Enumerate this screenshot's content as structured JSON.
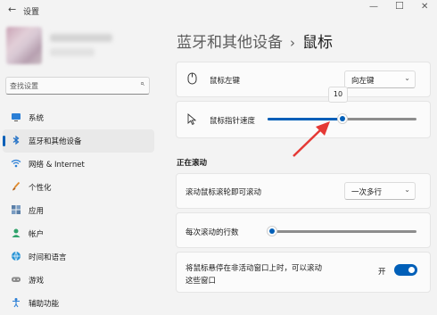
{
  "window": {
    "title": "设置",
    "back_glyph": "←",
    "minimize_glyph": "—",
    "maximize_glyph": "☐",
    "close_glyph": "✕"
  },
  "search": {
    "placeholder": "查找设置",
    "value": ""
  },
  "sidebar": {
    "items": [
      {
        "label": "系统",
        "icon": "monitor-icon",
        "active": false
      },
      {
        "label": "蓝牙和其他设备",
        "icon": "bluetooth-icon",
        "active": true
      },
      {
        "label": "网络 & Internet",
        "icon": "wifi-icon",
        "active": false
      },
      {
        "label": "个性化",
        "icon": "brush-icon",
        "active": false
      },
      {
        "label": "应用",
        "icon": "apps-icon",
        "active": false
      },
      {
        "label": "帐户",
        "icon": "person-icon",
        "active": false
      },
      {
        "label": "时间和语言",
        "icon": "globe-clock-icon",
        "active": false
      },
      {
        "label": "游戏",
        "icon": "gamepad-icon",
        "active": false
      },
      {
        "label": "辅助功能",
        "icon": "accessibility-icon",
        "active": false
      }
    ]
  },
  "breadcrumb": {
    "parent": "蓝牙和其他设备",
    "separator": "›",
    "current": "鼠标"
  },
  "settings": {
    "primary_button": {
      "label": "鼠标左键",
      "value": "向左键",
      "icon": "mouse-icon"
    },
    "pointer_speed": {
      "label": "鼠标指针速度",
      "value": 10,
      "max": 20,
      "tooltip": "10",
      "icon": "pointer-icon"
    },
    "scrolling_section": "正在滚动",
    "scroll_mode": {
      "label": "滚动鼠标滚轮即可滚动",
      "value": "一次多行"
    },
    "lines_per_scroll": {
      "label": "每次滚动的行数",
      "value": 3,
      "min": 1,
      "max": 100
    },
    "inactive_scroll": {
      "label_line1": "将鼠标悬停在非活动窗口上时，可以滚动",
      "label_line2": "这些窗口",
      "state_label": "开",
      "on": true
    }
  },
  "colors": {
    "accent": "#005fb8",
    "annotation_arrow": "#e53935"
  }
}
